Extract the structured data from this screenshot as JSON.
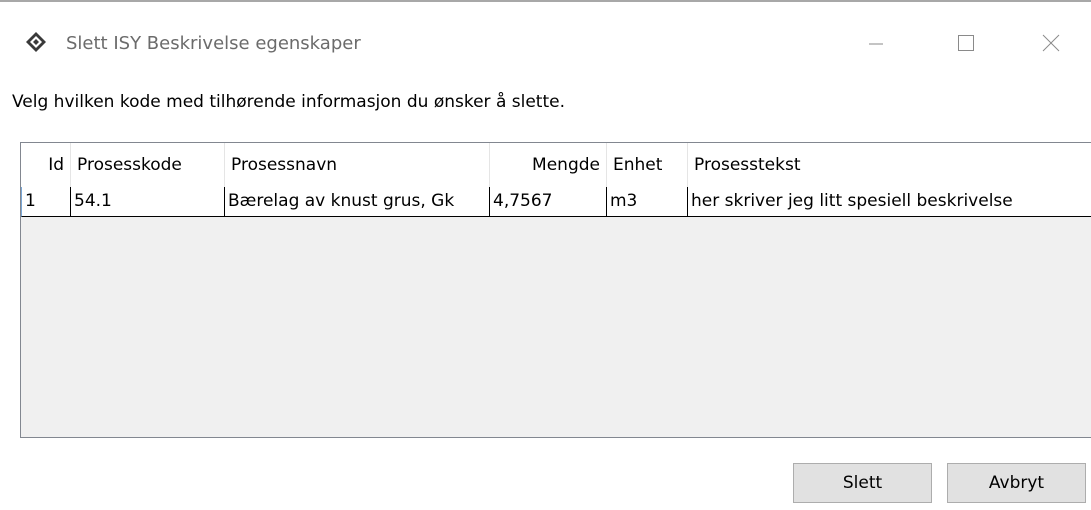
{
  "window": {
    "title": "Slett ISY Beskrivelse egenskaper",
    "app_icon": "diamond-app-icon",
    "controls": {
      "minimize": "minimize-icon",
      "maximize": "maximize-icon",
      "close": "close-icon"
    }
  },
  "instruction": "Velg hvilken kode med tilhørende informasjon du ønsker å slette.",
  "table": {
    "columns": [
      "Id",
      "Prosesskode",
      "Prosessnavn",
      "Mengde",
      "Enhet",
      "Prosesstekst"
    ],
    "rows": [
      {
        "id": "1",
        "prosesskode": "54.1",
        "prosessnavn": "Bærelag av knust grus, Gk",
        "mengde": "4,7567",
        "enhet": "m3",
        "prosesstekst": "her skriver jeg litt spesiell beskrivelse"
      }
    ]
  },
  "buttons": {
    "delete": "Slett",
    "cancel": "Avbryt"
  }
}
